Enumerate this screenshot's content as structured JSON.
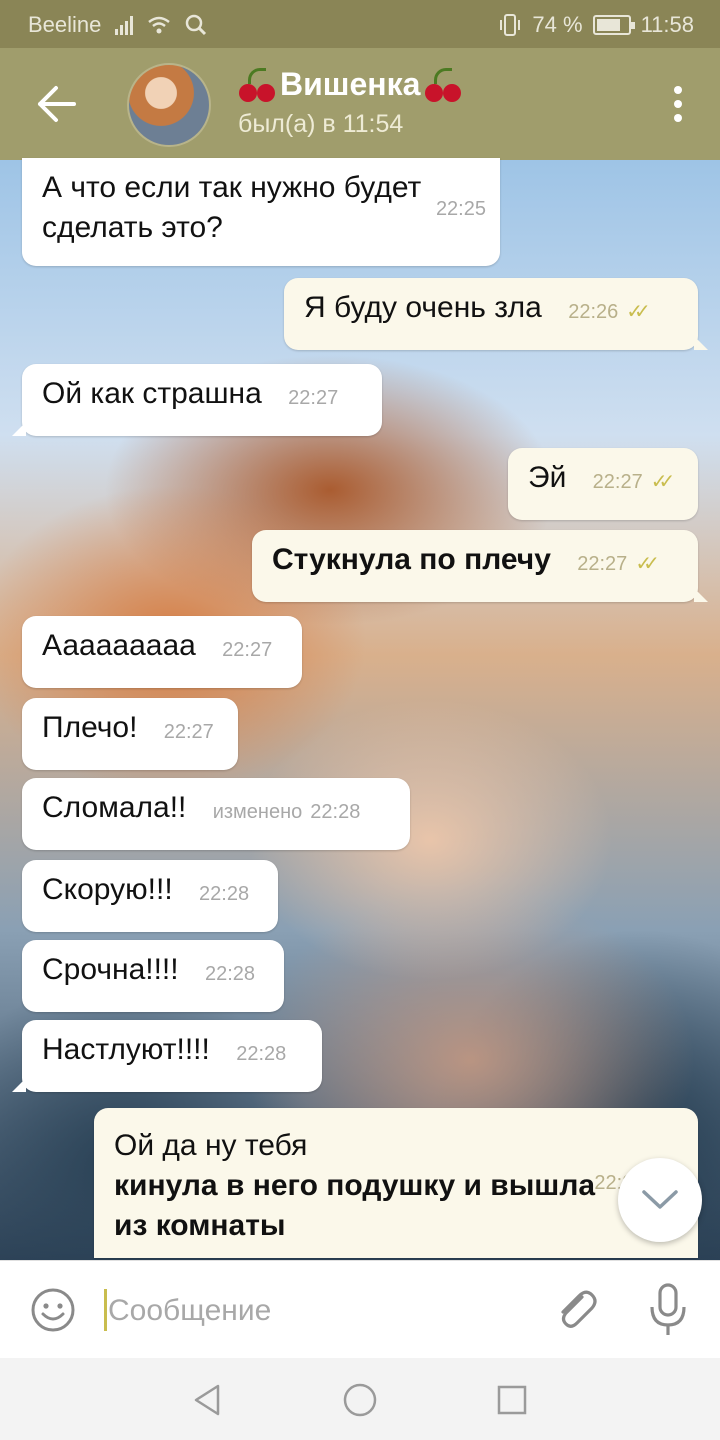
{
  "status_bar": {
    "carrier": "Beeline",
    "battery": "74 %",
    "time": "11:58",
    "icons": [
      "signal-icon",
      "wifi-icon",
      "search-icon",
      "vibrate-icon",
      "battery-icon"
    ]
  },
  "header": {
    "title": "Вишенка",
    "status": "был(а) в 11:54",
    "icons": [
      "back-arrow-icon",
      "cherry-icon",
      "more-vert-icon"
    ]
  },
  "messages": [
    {
      "dir": "in",
      "text": "А что если так нужно будет сделать это?",
      "time": "22:25"
    },
    {
      "dir": "out",
      "text": "Я буду очень зла",
      "time": "22:26",
      "read": true
    },
    {
      "dir": "in",
      "text": "Ой как страшна",
      "time": "22:27"
    },
    {
      "dir": "out",
      "text": "Эй",
      "time": "22:27",
      "read": true
    },
    {
      "dir": "out",
      "text": "Стукнула по плечу",
      "time": "22:27",
      "read": true,
      "bold": true
    },
    {
      "dir": "in",
      "text": "Ааааааааа",
      "time": "22:27"
    },
    {
      "dir": "in",
      "text": "Плечо!",
      "time": "22:27"
    },
    {
      "dir": "in",
      "text": "Сломала!!",
      "time": "22:28",
      "edited": "изменено"
    },
    {
      "dir": "in",
      "text": "Скорую!!!",
      "time": "22:28"
    },
    {
      "dir": "in",
      "text": "Срочна!!!!",
      "time": "22:28"
    },
    {
      "dir": "in",
      "text": "Настлуют!!!!",
      "time": "22:28"
    },
    {
      "dir": "out",
      "text": "Ой да ну тебя",
      "bold_text": "кинула в него подушку и вышла из комнаты",
      "time": "22:28",
      "read": true
    }
  ],
  "input": {
    "placeholder": "Сообщение",
    "icons": [
      "emoji-icon",
      "attach-icon",
      "microphone-icon",
      "scroll-down-icon"
    ]
  },
  "nav_bar": {
    "icons": [
      "nav-back-icon",
      "nav-home-icon",
      "nav-recents-icon"
    ]
  },
  "colors": {
    "header": "#a09d6c",
    "status_bar": "#8a8556",
    "bubble_in": "#ffffff",
    "bubble_out": "#fbf8ea",
    "read_checks": "#c9bd4e"
  }
}
